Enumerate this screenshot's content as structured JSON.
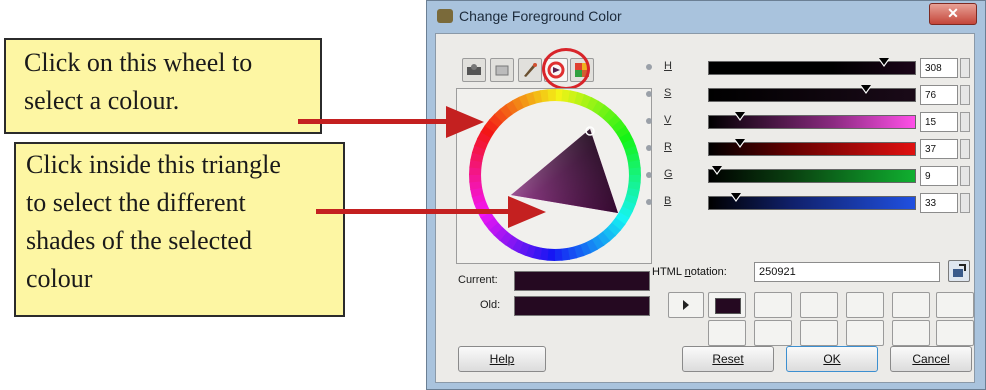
{
  "callouts": {
    "wheel_text_line1": "Click on this wheel to",
    "wheel_text_line2": "select a colour.",
    "triangle_text_line1": "Click inside this triangle",
    "triangle_text_line2": "to select the different",
    "triangle_text_line3": "shades of the selected",
    "triangle_text_line4": "colour"
  },
  "dialog": {
    "title": "Change Foreground Color",
    "close_label": "✕"
  },
  "swatches": {
    "current_label": "Current:",
    "old_label": "Old:"
  },
  "sliders": [
    {
      "letter": "H",
      "value": "308",
      "fraction": 0.85
    },
    {
      "letter": "S",
      "value": "76",
      "fraction": 0.76
    },
    {
      "letter": "V",
      "value": "15",
      "fraction": 0.15
    },
    {
      "letter": "R",
      "value": "37",
      "fraction": 0.15
    },
    {
      "letter": "G",
      "value": "9",
      "fraction": 0.04
    },
    {
      "letter": "B",
      "value": "33",
      "fraction": 0.13
    }
  ],
  "html_notation": {
    "label_prefix": "HTML ",
    "label_underlined": "n",
    "label_suffix": "otation:",
    "value": "250921"
  },
  "buttons": {
    "help": "Help",
    "reset": "Reset",
    "ok": "OK",
    "cancel": "Cancel"
  },
  "colors": {
    "current": "#250921",
    "highlight": "#d8242a",
    "callout_bg": "#fdf6a3",
    "arrow": "#c42020"
  }
}
